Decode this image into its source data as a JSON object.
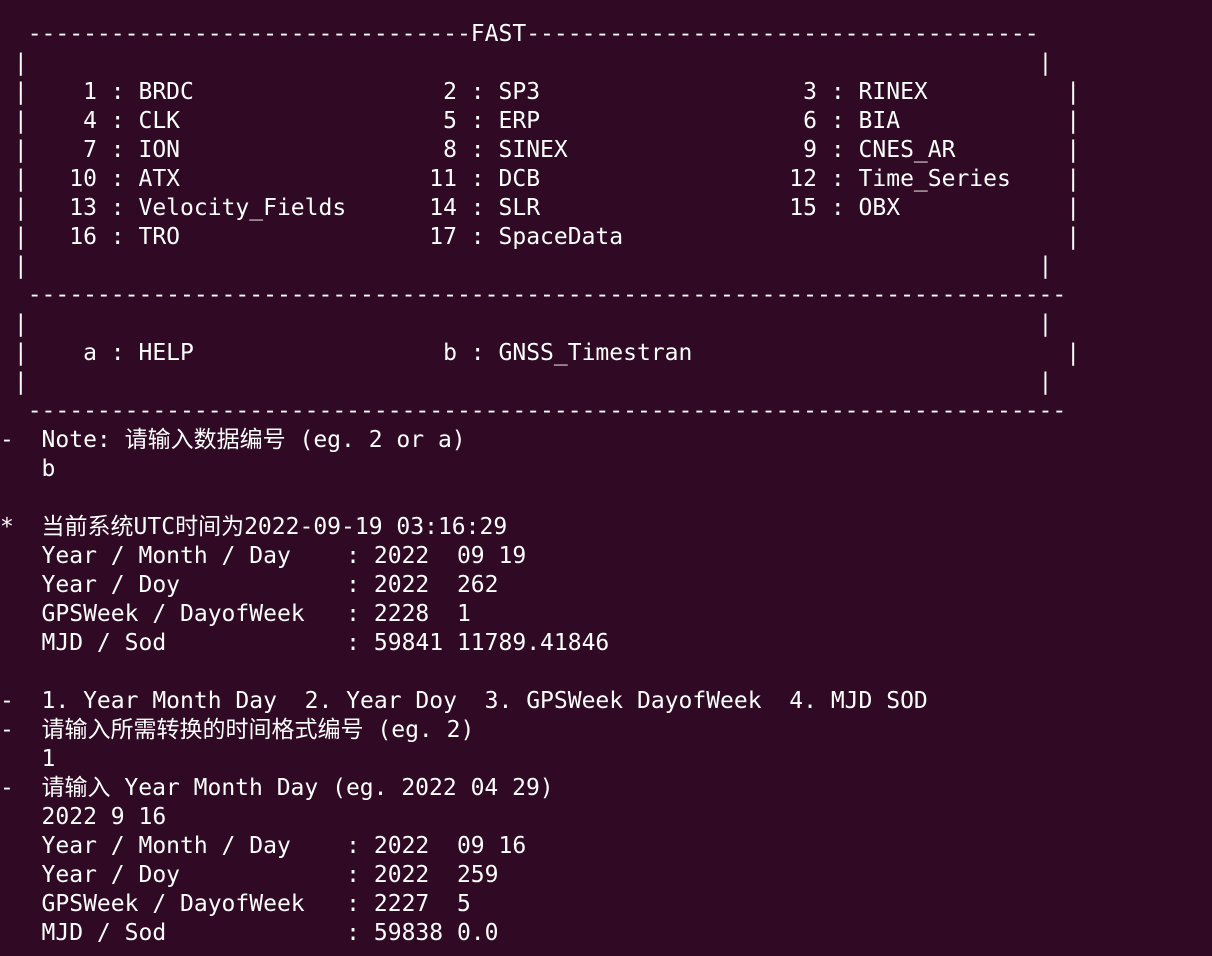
{
  "window": {
    "title": "FAST"
  },
  "menu": {
    "top_border": "  --------------------------------FAST-------------------------------------",
    "blank_row": " |                                                                         |",
    "rows": [
      " |    1 : BRDC                  2 : SP3                   3 : RINEX          |",
      " |    4 : CLK                   5 : ERP                   6 : BIA            |",
      " |    7 : ION                   8 : SINEX                 9 : CNES_AR        |",
      " |   10 : ATX                  11 : DCB                  12 : Time_Series    |",
      " |   13 : Velocity_Fields      14 : SLR                  15 : OBX            |",
      " |   16 : TRO                  17 : SpaceData                                |"
    ],
    "separator": "  ---------------------------------------------------------------------------",
    "tools_row": " |    a : HELP                  b : GNSS_Timestran                           |",
    "bottom_border": "  ---------------------------------------------------------------------------"
  },
  "session": {
    "prompt_note": "-  Note: 请输入数据编号 (eg. 2 or a)",
    "input_1": "   b",
    "current_utc": "*  当前系统UTC时间为2022-09-19 03:16:29",
    "now_ymd": "   Year / Month / Day    : 2022  09 19",
    "now_doy": "   Year / Doy            : 2022  262",
    "now_gpsweek": "   GPSWeek / DayofWeek   : 2228  1",
    "now_mjd": "   MJD / Sod             : 59841 11789.41846",
    "format_options": "-  1. Year Month Day  2. Year Doy  3. GPSWeek DayofWeek  4. MJD SOD",
    "prompt_format": "-  请输入所需转换的时间格式编号 (eg. 2)",
    "input_2": "   1",
    "prompt_ymd": "-  请输入 Year Month Day (eg. 2022 04 29)",
    "input_3": "   2022 9 16",
    "res_ymd": "   Year / Month / Day    : 2022  09 16",
    "res_doy": "   Year / Doy            : 2022  259",
    "res_gpsweek": "   GPSWeek / DayofWeek   : 2227  5",
    "res_mjd": "   MJD / Sod             : 59838 0.0"
  },
  "colors": {
    "background": "#300a24",
    "foreground": "#ffffff"
  }
}
